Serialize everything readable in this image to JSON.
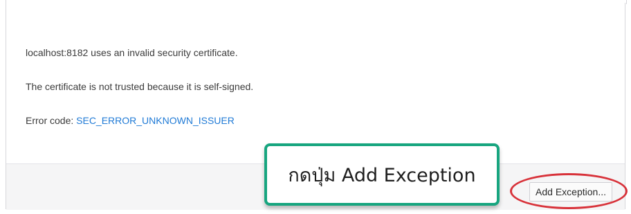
{
  "message": {
    "line1": "localhost:8182 uses an invalid security certificate.",
    "line2": "The certificate is not trusted because it is self-signed.",
    "error_label": "Error code: ",
    "error_code": "SEC_ERROR_UNKNOWN_ISSUER"
  },
  "footer": {
    "add_exception_label": "Add Exception..."
  },
  "annotation": {
    "callout_text": "กดปุ่ม Add Exception",
    "callout_border_color": "#17a57f",
    "highlight_color": "#d8323a"
  }
}
